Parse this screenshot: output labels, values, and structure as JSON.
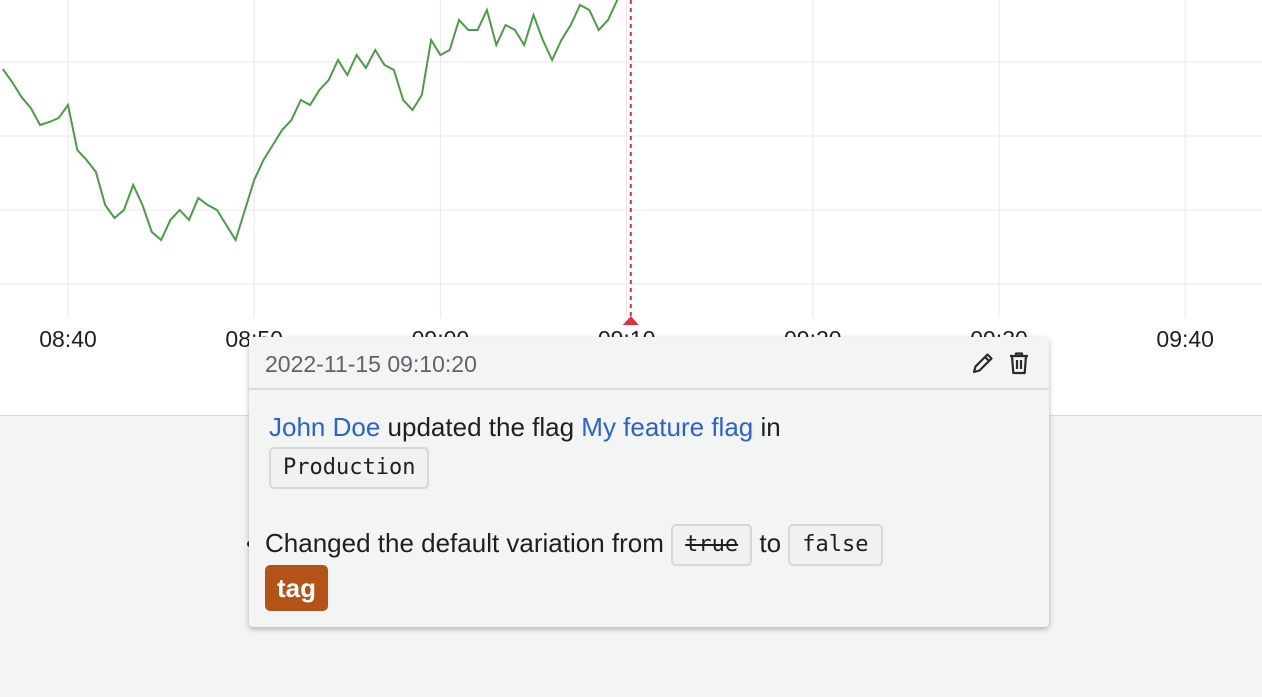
{
  "chart_data": {
    "type": "line",
    "x_ticks": [
      "08:40",
      "08:50",
      "09:00",
      "09:10",
      "09:20",
      "09:30",
      "09:40"
    ],
    "series": [
      {
        "color": "#4a9d45",
        "x_minutes": [
          36.5,
          37.0,
          37.5,
          38.0,
          38.5,
          39.0,
          39.5,
          40.0,
          40.5,
          41.0,
          41.5,
          42.0,
          42.5,
          43.0,
          43.5,
          44.0,
          44.5,
          45.0,
          45.5,
          46.0,
          46.5,
          47.0,
          47.5,
          48.0,
          48.5,
          49.0,
          49.5,
          50.0,
          50.5,
          51.0,
          51.5,
          52.0,
          52.5,
          53.0,
          53.5,
          54.0,
          54.5,
          55.0,
          55.5,
          56.0,
          56.5,
          57.0,
          57.5,
          58.0,
          58.5,
          59.0,
          59.5,
          60.0,
          60.5,
          61.0,
          61.5,
          62.0,
          62.5,
          63.0,
          63.5,
          64.0,
          64.5,
          65.0,
          65.5,
          66.0,
          66.5,
          67.0,
          67.5,
          68.0,
          68.5,
          69.0,
          69.5
        ],
        "values": [
          69,
          82,
          97,
          108,
          125,
          122,
          118,
          105,
          150,
          160,
          172,
          205,
          218,
          210,
          185,
          205,
          232,
          240,
          220,
          210,
          220,
          198,
          205,
          210,
          225,
          240,
          210,
          180,
          160,
          145,
          130,
          120,
          100,
          105,
          90,
          80,
          60,
          75,
          55,
          68,
          50,
          65,
          70,
          100,
          110,
          95,
          40,
          55,
          50,
          20,
          30,
          30,
          10,
          45,
          25,
          30,
          45,
          15,
          40,
          60,
          40,
          25,
          5,
          10,
          30,
          20,
          0
        ]
      }
    ],
    "annotation": {
      "time": "09:10"
    }
  },
  "tooltip": {
    "timestamp": "2022-11-15 09:10:20",
    "edit_icon": "pencil-icon",
    "delete_icon": "trash-icon",
    "user": "John Doe",
    "action": "updated the flag",
    "flag_name": "My feature flag",
    "in_text": "in",
    "environment": "Production",
    "change_prefix": "Changed the default variation from",
    "old_value": "true",
    "to_text": "to",
    "new_value": "false",
    "tag": "tag"
  },
  "colors": {
    "line": "#4a9d45",
    "annotation_marker": "#e0303f",
    "link": "#2a62d3",
    "tag": "#b35317"
  }
}
